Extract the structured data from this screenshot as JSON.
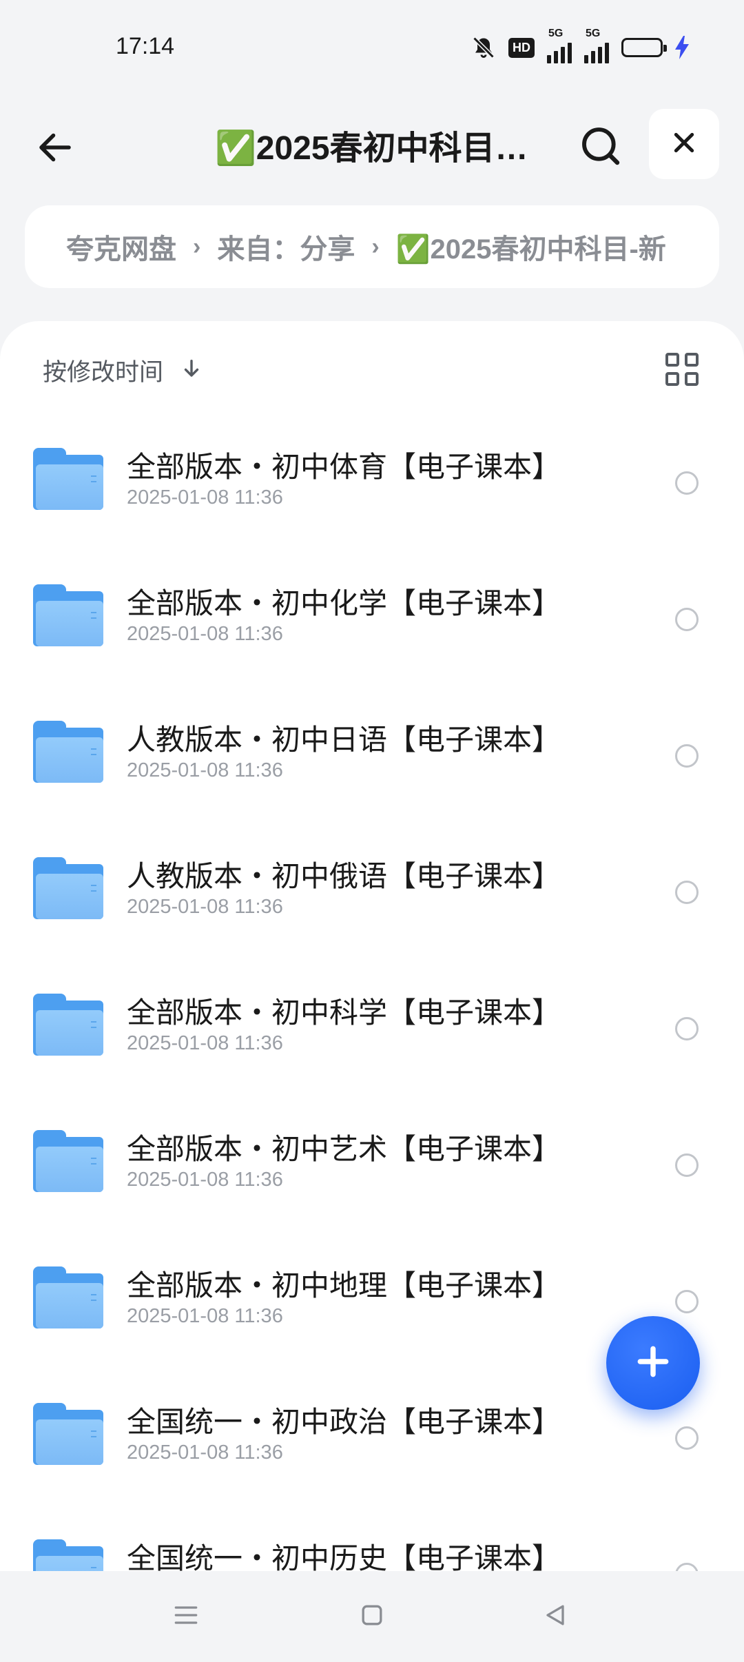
{
  "status_bar": {
    "time": "17:14",
    "icons": [
      "bell-off-icon",
      "hd-icon",
      "signal-5g-icon",
      "signal-5g-icon",
      "battery-icon",
      "charging-icon"
    ],
    "hd_label": "HD",
    "net_label": "5G",
    "battery_color": "#3b4ef0"
  },
  "header": {
    "title": "✅2025春初中科目…",
    "back_icon": "arrow-left-icon",
    "search_icon": "search-icon",
    "close_icon": "close-icon"
  },
  "breadcrumb": {
    "items": [
      "夸克网盘",
      "来自：分享",
      "✅2025春初中科目-新"
    ],
    "separator": "›"
  },
  "toolbar": {
    "sort_label": "按修改时间",
    "sort_icon": "arrow-down-icon",
    "view_icon": "grid-view-icon"
  },
  "files": [
    {
      "name": "全部版本・初中体育【电子课本】",
      "date": "2025-01-08 11:36"
    },
    {
      "name": "全部版本・初中化学【电子课本】",
      "date": "2025-01-08 11:36"
    },
    {
      "name": "人教版本・初中日语【电子课本】",
      "date": "2025-01-08 11:36"
    },
    {
      "name": "人教版本・初中俄语【电子课本】",
      "date": "2025-01-08 11:36"
    },
    {
      "name": "全部版本・初中科学【电子课本】",
      "date": "2025-01-08 11:36"
    },
    {
      "name": "全部版本・初中艺术【电子课本】",
      "date": "2025-01-08 11:36"
    },
    {
      "name": "全部版本・初中地理【电子课本】",
      "date": "2025-01-08 11:36"
    },
    {
      "name": "全国统一・初中政治【电子课本】",
      "date": "2025-01-08 11:36"
    },
    {
      "name": "全国统一・初中历史【电子课本】",
      "date": ""
    }
  ],
  "fab": {
    "icon": "plus-icon",
    "color": "#1a5ef0"
  },
  "nav_bar": {
    "icons": [
      "menu-icon",
      "home-square-icon",
      "back-triangle-icon"
    ]
  }
}
